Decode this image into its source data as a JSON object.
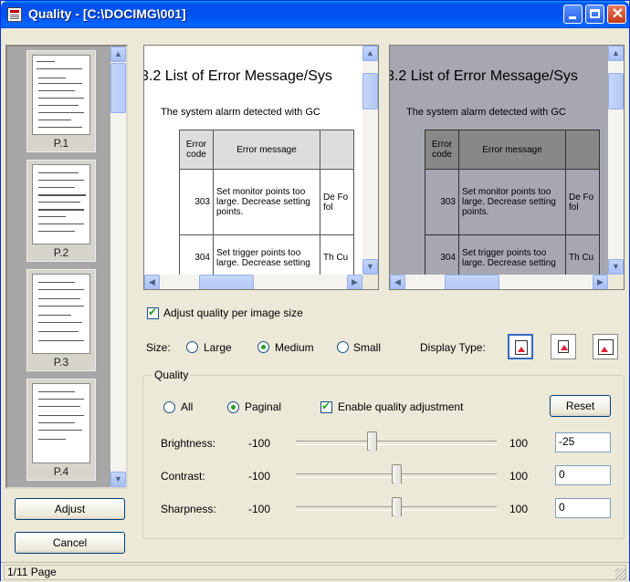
{
  "window": {
    "title": "Quality - [C:\\DOCIMG\\001]"
  },
  "thumbnails": [
    {
      "label": "P.1",
      "selected": true
    },
    {
      "label": "P.2",
      "selected": false
    },
    {
      "label": "P.3",
      "selected": false
    },
    {
      "label": "P.4",
      "selected": false
    }
  ],
  "buttons": {
    "adjust": "Adjust",
    "cancel": "Cancel",
    "reset": "Reset"
  },
  "preview": {
    "heading": "3.2   List of Error Message/Sys",
    "intro": "The system alarm detected with GC",
    "table": {
      "col_code": "Error code",
      "col_message": "Error message",
      "rows": [
        {
          "code": "303",
          "message": "Set monitor points too large. Decrease setting points.",
          "next": "De Fo fol"
        },
        {
          "code": "304",
          "message": "Set trigger points too large. Decrease setting",
          "next": "Th Cu"
        }
      ]
    }
  },
  "options": {
    "adjust_per_size": "Adjust quality per image size",
    "size_label": "Size:",
    "size_large": "Large",
    "size_medium": "Medium",
    "size_small": "Small",
    "size_selected": "Medium",
    "display_type_label": "Display Type:"
  },
  "quality": {
    "group_label": "Quality",
    "all_label": "All",
    "paginal_label": "Paginal",
    "mode_selected": "Paginal",
    "enable_label": "Enable quality adjustment",
    "enable_checked": true,
    "sliders": [
      {
        "label": "Brightness:",
        "min": "-100",
        "max": "100",
        "value": "-25"
      },
      {
        "label": "Contrast:",
        "min": "-100",
        "max": "100",
        "value": "0"
      },
      {
        "label": "Sharpness:",
        "min": "-100",
        "max": "100",
        "value": "0"
      }
    ]
  },
  "status": {
    "text": "1/11 Page"
  },
  "colors": {
    "titlebar": "#0053ee",
    "face": "#ece9d8",
    "check": "#21a121",
    "dim_preview": "#a6a7b1"
  }
}
